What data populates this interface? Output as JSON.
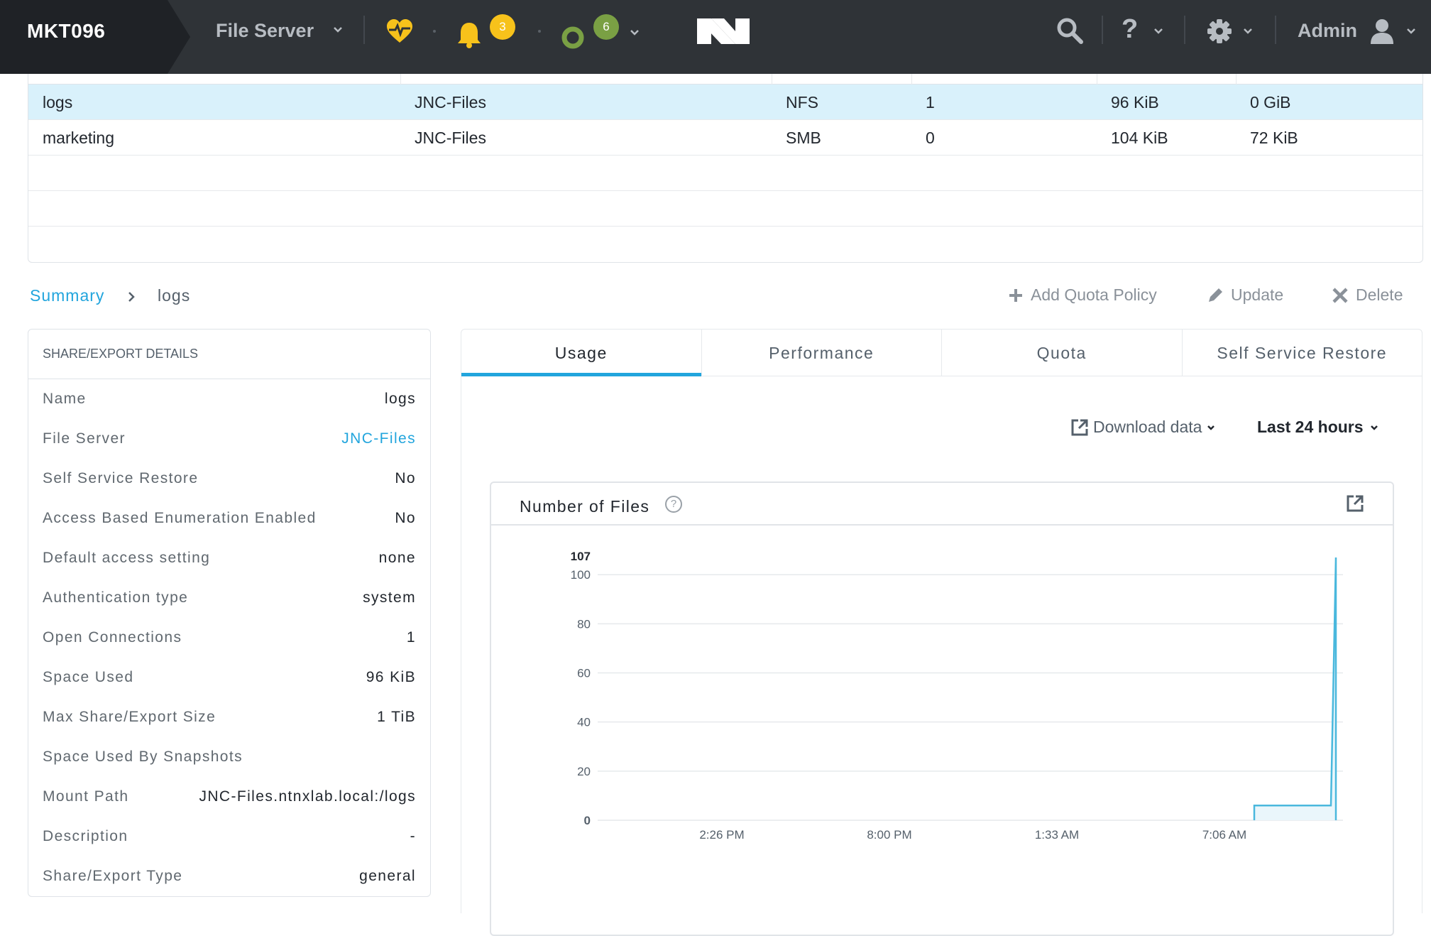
{
  "topbar": {
    "cluster_name": "MKT096",
    "module": "File Server",
    "alerts_count": "3",
    "tasks_count": "6",
    "user": "Admin",
    "help_glyph": "?",
    "colors": {
      "bar": "#2f3337",
      "alert": "#f7c21b",
      "task": "#7aa044",
      "health": "#f7c21b"
    }
  },
  "table": {
    "rows": [
      {
        "name": "logs",
        "file_server": "JNC-Files",
        "protocol": "NFS",
        "connections": "1",
        "used": "96 KiB",
        "snapshots": "0 GiB"
      },
      {
        "name": "marketing",
        "file_server": "JNC-Files",
        "protocol": "SMB",
        "connections": "0",
        "used": "104 KiB",
        "snapshots": "72 KiB"
      }
    ]
  },
  "breadcrumb": {
    "root": "Summary",
    "current": "logs"
  },
  "actions": {
    "add_quota": "Add Quota Policy",
    "update": "Update",
    "delete": "Delete"
  },
  "details": {
    "title": "SHARE/EXPORT DETAILS",
    "rows": [
      {
        "key": "Name",
        "value": "logs"
      },
      {
        "key": "File Server",
        "value": "JNC-Files"
      },
      {
        "key": "Self Service Restore",
        "value": "No"
      },
      {
        "key": "Access Based Enumeration Enabled",
        "value": "No"
      },
      {
        "key": "Default access setting",
        "value": "none"
      },
      {
        "key": "Authentication type",
        "value": "system"
      },
      {
        "key": "Open Connections",
        "value": "1"
      },
      {
        "key": "Space Used",
        "value": "96 KiB"
      },
      {
        "key": "Max Share/Export Size",
        "value": "1 TiB"
      },
      {
        "key": "Space Used By Snapshots",
        "value": ""
      },
      {
        "key": "Mount Path",
        "value": "JNC-Files.ntnxlab.local:/logs"
      },
      {
        "key": "Description",
        "value": "-"
      },
      {
        "key": "Share/Export Type",
        "value": "general"
      }
    ]
  },
  "tabs": {
    "usage": "Usage",
    "performance": "Performance",
    "quota": "Quota",
    "ssr": "Self Service Restore"
  },
  "toolbar": {
    "download": "Download data",
    "range": "Last 24 hours"
  },
  "chart_title": "Number of Files",
  "chart_data": {
    "type": "area",
    "title": "Number of Files",
    "xlabel": "",
    "ylabel": "",
    "y_ticks": [
      0,
      20,
      40,
      60,
      80,
      100
    ],
    "y_max_label": "107",
    "ylim": [
      0,
      107
    ],
    "x_ticks": [
      "2:26 PM",
      "8:00 PM",
      "1:33 AM",
      "7:06 AM"
    ],
    "series": [
      {
        "points": [
          {
            "x": "7:06 AM + ~0.3h",
            "y": 6
          },
          {
            "x": "~9:50 AM",
            "y": 6
          },
          {
            "x": "~10:00 AM",
            "y": 107
          }
        ]
      }
    ],
    "grid": true,
    "color": "#4ab8dd"
  }
}
